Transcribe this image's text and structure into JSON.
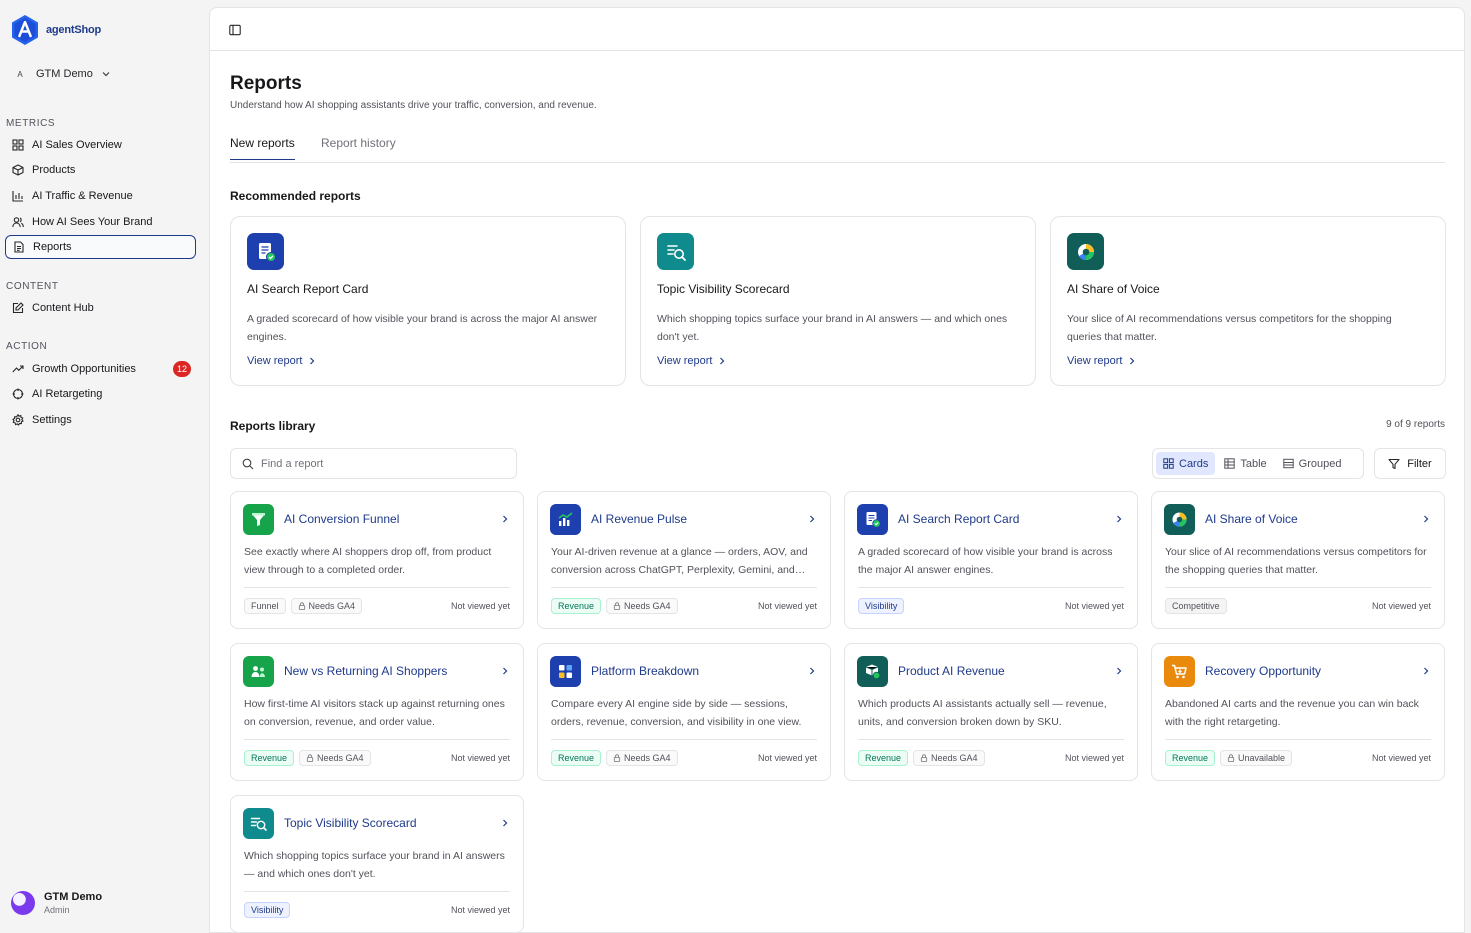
{
  "brand": {
    "name": "agentShop"
  },
  "workspace": {
    "initial": "A",
    "name": "GTM Demo"
  },
  "sidebar": {
    "sections": [
      {
        "label": "METRICS"
      },
      {
        "label": "CONTENT"
      },
      {
        "label": "ACTION"
      }
    ],
    "items": [
      {
        "label": "AI Sales Overview",
        "icon": "grid-icon"
      },
      {
        "label": "Products",
        "icon": "box-icon"
      },
      {
        "label": "AI Traffic & Revenue",
        "icon": "bar-chart-icon"
      },
      {
        "label": "How AI Sees Your Brand",
        "icon": "users-icon"
      },
      {
        "label": "Reports",
        "icon": "document-icon",
        "active": true
      },
      {
        "label": "Content Hub",
        "icon": "edit-icon"
      },
      {
        "label": "Growth Opportunities",
        "icon": "trending-up-icon",
        "badge": "12"
      },
      {
        "label": "AI Retargeting",
        "icon": "target-icon"
      },
      {
        "label": "Settings",
        "icon": "gear-icon"
      }
    ]
  },
  "user": {
    "name": "GTM Demo",
    "role": "Admin"
  },
  "page": {
    "title": "Reports",
    "subtitle": "Understand how AI shopping assistants drive your traffic, conversion, and revenue.",
    "tabs": [
      {
        "label": "New reports",
        "active": true
      },
      {
        "label": "Report history",
        "active": false
      }
    ]
  },
  "recommended": {
    "heading": "Recommended reports",
    "link_label": "View report",
    "cards": [
      {
        "title": "AI Search Report Card",
        "desc": "A graded scorecard of how visible your brand is across the major AI answer engines.",
        "icon": "report-card-icon",
        "color": "#1e40af"
      },
      {
        "title": "Topic Visibility Scorecard",
        "desc": "Which shopping topics surface your brand in AI answers — and which ones don't yet.",
        "icon": "topic-search-icon",
        "color": "#0f8b8d"
      },
      {
        "title": "AI Share of Voice",
        "desc": "Your slice of AI recommendations versus competitors for the shopping queries that matter.",
        "icon": "pie-chart-icon",
        "color": "#115e59"
      }
    ]
  },
  "library": {
    "heading": "Reports library",
    "count": "9 of 9 reports",
    "search_placeholder": "Find a report",
    "views": [
      {
        "label": "Cards",
        "active": true
      },
      {
        "label": "Table",
        "active": false
      },
      {
        "label": "Grouped",
        "active": false
      }
    ],
    "filter_label": "Filter",
    "cards": [
      {
        "title": "AI Conversion Funnel",
        "desc": "See exactly where AI shoppers drop off, from product view through to a completed order.",
        "tags": [
          {
            "label": "Funnel",
            "kind": "plain"
          },
          {
            "label": "Needs GA4",
            "kind": "lock"
          }
        ],
        "status": "Not viewed yet",
        "icon": "funnel-icon",
        "color": "#16a34a"
      },
      {
        "title": "AI Revenue Pulse",
        "desc": "Your AI-driven revenue at a glance — orders, AOV, and conversion across ChatGPT, Perplexity, Gemini, and more.",
        "tags": [
          {
            "label": "Revenue",
            "kind": "revenue"
          },
          {
            "label": "Needs GA4",
            "kind": "lock"
          }
        ],
        "status": "Not viewed yet",
        "icon": "revenue-chart-icon",
        "color": "#1e40af"
      },
      {
        "title": "AI Search Report Card",
        "desc": "A graded scorecard of how visible your brand is across the major AI answer engines.",
        "tags": [
          {
            "label": "Visibility",
            "kind": "visibility"
          }
        ],
        "status": "Not viewed yet",
        "icon": "report-card-icon",
        "color": "#1e40af"
      },
      {
        "title": "AI Share of Voice",
        "desc": "Your slice of AI recommendations versus competitors for the shopping queries that matter.",
        "tags": [
          {
            "label": "Competitive",
            "kind": "competitive"
          }
        ],
        "status": "Not viewed yet",
        "icon": "pie-chart-icon",
        "color": "#115e59"
      },
      {
        "title": "New vs Returning AI Shoppers",
        "desc": "How first-time AI visitors stack up against returning ones on conversion, revenue, and order value.",
        "tags": [
          {
            "label": "Revenue",
            "kind": "revenue"
          },
          {
            "label": "Needs GA4",
            "kind": "lock"
          }
        ],
        "status": "Not viewed yet",
        "icon": "shoppers-icon",
        "color": "#16a34a"
      },
      {
        "title": "Platform Breakdown",
        "desc": "Compare every AI engine side by side — sessions, orders, revenue, conversion, and visibility in one view.",
        "tags": [
          {
            "label": "Revenue",
            "kind": "revenue"
          },
          {
            "label": "Needs GA4",
            "kind": "lock"
          }
        ],
        "status": "Not viewed yet",
        "icon": "platform-grid-icon",
        "color": "#1e40af"
      },
      {
        "title": "Product AI Revenue",
        "desc": "Which products AI assistants actually sell — revenue, units, and conversion broken down by SKU.",
        "tags": [
          {
            "label": "Revenue",
            "kind": "revenue"
          },
          {
            "label": "Needs GA4",
            "kind": "lock"
          }
        ],
        "status": "Not viewed yet",
        "icon": "product-revenue-icon",
        "color": "#115e59"
      },
      {
        "title": "Recovery Opportunity",
        "desc": "Abandoned AI carts and the revenue you can win back with the right retargeting.",
        "tags": [
          {
            "label": "Revenue",
            "kind": "revenue"
          },
          {
            "label": "Unavailable",
            "kind": "lock"
          }
        ],
        "status": "Not viewed yet",
        "icon": "cart-icon",
        "color": "#ea8a0c"
      },
      {
        "title": "Topic Visibility Scorecard",
        "desc": "Which shopping topics surface your brand in AI answers — and which ones don't yet.",
        "tags": [
          {
            "label": "Visibility",
            "kind": "visibility"
          }
        ],
        "status": "Not viewed yet",
        "icon": "topic-search-icon",
        "color": "#0f8b8d"
      }
    ]
  }
}
